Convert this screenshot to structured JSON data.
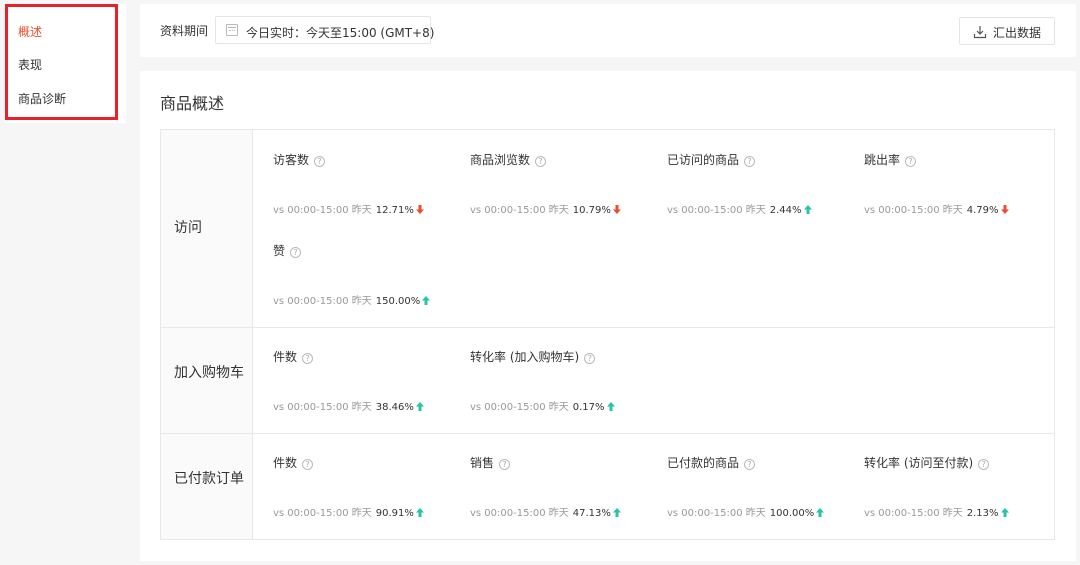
{
  "sidebar": {
    "items": [
      {
        "label": "概述",
        "active": true
      },
      {
        "label": "表现",
        "active": false
      },
      {
        "label": "商品诊断",
        "active": false
      }
    ]
  },
  "topbar": {
    "period_label": "资料期间",
    "period_value": "今日实时：今天至15:00 (GMT+8)",
    "export_label": "汇出数据"
  },
  "panel": {
    "title": "商品概述"
  },
  "colors": {
    "accent": "#ee4d2d",
    "down": "#ee4d2d",
    "up": "#26c5a7",
    "highlight_border": "#e8212b"
  },
  "sections": [
    {
      "label": "访问",
      "metrics": [
        {
          "name": "访客数",
          "compare": "vs 00:00-15:00 昨天",
          "pct": "12.71%",
          "trend": "down"
        },
        {
          "name": "商品浏览数",
          "compare": "vs 00:00-15:00 昨天",
          "pct": "10.79%",
          "trend": "down"
        },
        {
          "name": "已访问的商品",
          "compare": "vs 00:00-15:00 昨天",
          "pct": "2.44%",
          "trend": "up"
        },
        {
          "name": "跳出率",
          "compare": "vs 00:00-15:00 昨天",
          "pct": "4.79%",
          "trend": "down"
        },
        {
          "name": "赞",
          "compare": "vs 00:00-15:00 昨天",
          "pct": "150.00%",
          "trend": "up"
        }
      ]
    },
    {
      "label": "加入购物车",
      "metrics": [
        {
          "name": "件数",
          "compare": "vs 00:00-15:00 昨天",
          "pct": "38.46%",
          "trend": "up"
        },
        {
          "name": "转化率 (加入购物车)",
          "compare": "vs 00:00-15:00 昨天",
          "pct": "0.17%",
          "trend": "up"
        }
      ]
    },
    {
      "label": "已付款订单",
      "metrics": [
        {
          "name": "件数",
          "compare": "vs 00:00-15:00 昨天",
          "pct": "90.91%",
          "trend": "up"
        },
        {
          "name": "销售",
          "compare": "vs 00:00-15:00 昨天",
          "pct": "47.13%",
          "trend": "up"
        },
        {
          "name": "已付款的商品",
          "compare": "vs 00:00-15:00 昨天",
          "pct": "100.00%",
          "trend": "up"
        },
        {
          "name": "转化率 (访问至付款)",
          "compare": "vs 00:00-15:00 昨天",
          "pct": "2.13%",
          "trend": "up"
        }
      ]
    }
  ]
}
